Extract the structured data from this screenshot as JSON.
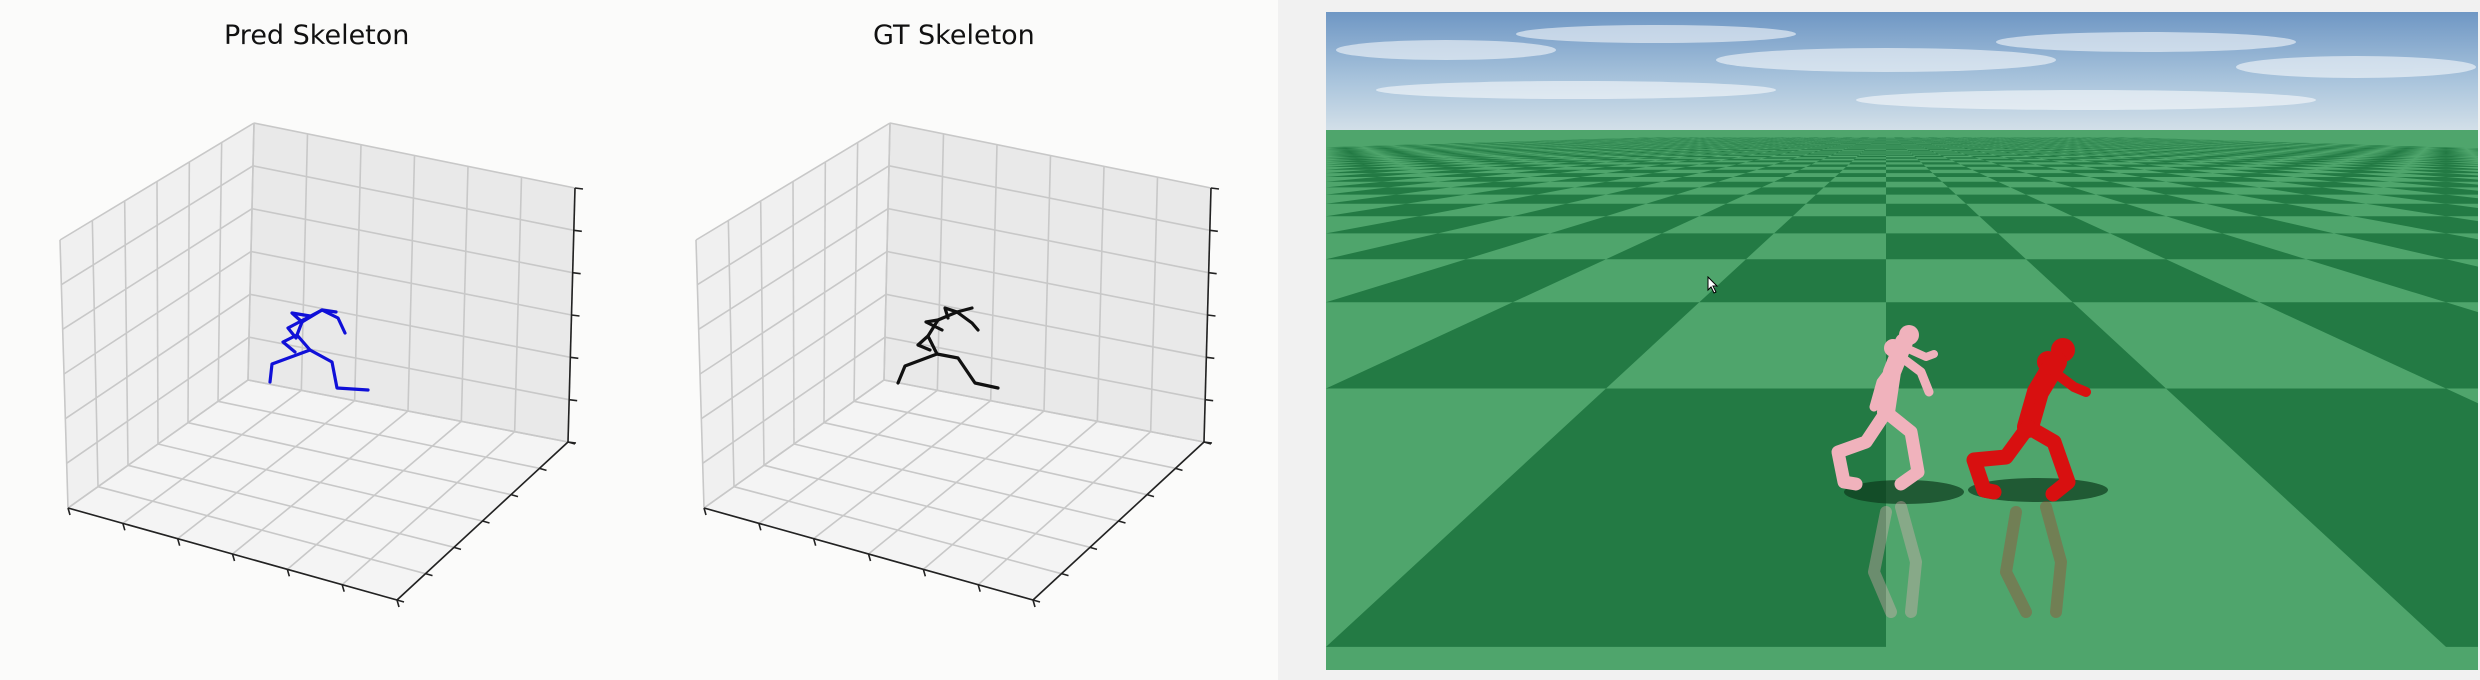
{
  "plots": {
    "pred": {
      "title": "Pred Skeleton",
      "skeleton_color": "#1010d8"
    },
    "gt": {
      "title": "GT Skeleton",
      "skeleton_color": "#111111"
    }
  },
  "simulation": {
    "sky_color": "#a8c4de",
    "floor_light_color": "#4fa56c",
    "floor_dark_color": "#237a44",
    "pred_character_color": "#f0b2bc",
    "gt_character_color": "#d81010"
  }
}
